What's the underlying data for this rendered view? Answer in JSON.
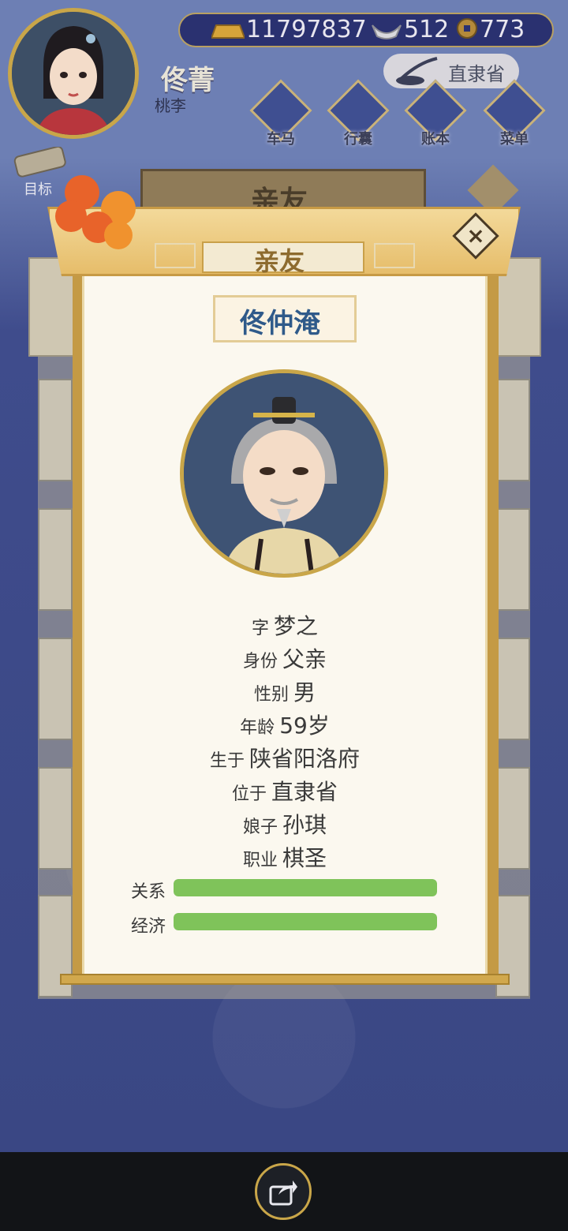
{
  "player": {
    "name": "佟菁",
    "subtitle": "桃李"
  },
  "currencies": [
    {
      "icon": "gold-ingot-icon",
      "value": "11797837"
    },
    {
      "icon": "silver-ingot-icon",
      "value": "512"
    },
    {
      "icon": "copper-coin-icon",
      "value": "773"
    }
  ],
  "location": "直隶省",
  "menu": [
    {
      "label": "车马",
      "icon": "carriage-icon"
    },
    {
      "label": "行囊",
      "icon": "bag-icon"
    },
    {
      "label": "账本",
      "icon": "ledger-icon"
    },
    {
      "label": "菜单",
      "icon": "more-icon"
    }
  ],
  "goal_label": "目标",
  "background_panel_title": "亲友",
  "modal": {
    "title": "亲友",
    "character_name": "佟仲淹",
    "info": [
      {
        "key": "字",
        "value": "梦之"
      },
      {
        "key": "身份",
        "value": "父亲"
      },
      {
        "key": "性别",
        "value": "男"
      },
      {
        "key": "年龄",
        "value": "59岁"
      },
      {
        "key": "生于",
        "value": "陕省阳洛府"
      },
      {
        "key": "位于",
        "value": "直隶省"
      },
      {
        "key": "娘子",
        "value": "孙琪"
      },
      {
        "key": "职业",
        "value": "棋圣"
      }
    ],
    "bars": [
      {
        "label": "关系",
        "fraction": 1.0,
        "color": "#7fc35a"
      },
      {
        "label": "经济",
        "fraction": 1.0,
        "color": "#7fc35a"
      }
    ]
  },
  "bottom_bar": {
    "share_icon": "share-icon"
  }
}
